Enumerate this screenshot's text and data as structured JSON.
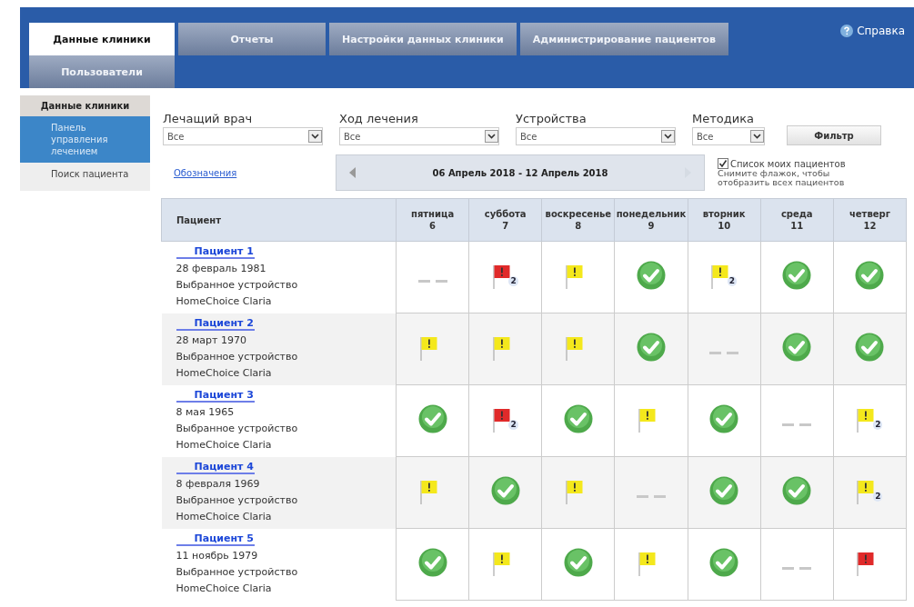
{
  "tabs": [
    {
      "label": "Данные клиники",
      "selected": true
    },
    {
      "label": "Отчеты",
      "selected": false
    },
    {
      "label": "Настройки данных клиники",
      "selected": false
    },
    {
      "label": "Администрирование пациентов",
      "selected": false
    },
    {
      "label": "Пользователи",
      "selected": false
    }
  ],
  "help": "Справка",
  "sidebar": {
    "title": "Данные клиники",
    "items": [
      {
        "label": "Панель управления лечением",
        "selected": true
      },
      {
        "label": "Поиск пациента",
        "selected": false
      }
    ]
  },
  "filters": [
    {
      "label": "Лечащий врач",
      "value": "Все"
    },
    {
      "label": "Ход лечения",
      "value": "Все"
    },
    {
      "label": "Устройства",
      "value": "Все"
    },
    {
      "label": "Методика",
      "value": "Все"
    }
  ],
  "filter_button": "Фильтр",
  "legend_link": "Обозначения",
  "date_range": "06 Апрель 2018 - 12 Апрель 2018",
  "my_patients": {
    "label": "Список моих пациентов",
    "checked": true,
    "hint": "Снимите флажок, чтобы отобразить всех пациентов"
  },
  "table": {
    "patient_header": "Пациент",
    "days": [
      {
        "name": "пятница",
        "num": "6"
      },
      {
        "name": "суббота",
        "num": "7"
      },
      {
        "name": "воскресенье",
        "num": "8"
      },
      {
        "name": "понедельник",
        "num": "9"
      },
      {
        "name": "вторник",
        "num": "10"
      },
      {
        "name": "среда",
        "num": "11"
      },
      {
        "name": "четверг",
        "num": "12"
      }
    ],
    "rows": [
      {
        "name": "Пациент 1",
        "birth": "28 февраль 1981",
        "device_label": "Выбранное устройство",
        "device": "HomeChoice Claria",
        "cells": [
          {
            "kind": "none"
          },
          {
            "kind": "flag",
            "color": "#e02a2a",
            "badge": "2"
          },
          {
            "kind": "flag",
            "color": "#f4e81c"
          },
          {
            "kind": "check"
          },
          {
            "kind": "flag",
            "color": "#f4e81c",
            "badge": "2"
          },
          {
            "kind": "check"
          },
          {
            "kind": "check"
          }
        ]
      },
      {
        "name": "Пациент 2",
        "birth": "28 март 1970",
        "device_label": "Выбранное устройство",
        "device": "HomeChoice Claria",
        "cells": [
          {
            "kind": "flag",
            "color": "#f4e81c"
          },
          {
            "kind": "flag",
            "color": "#f4e81c"
          },
          {
            "kind": "flag",
            "color": "#f4e81c"
          },
          {
            "kind": "check"
          },
          {
            "kind": "none"
          },
          {
            "kind": "check"
          },
          {
            "kind": "check"
          }
        ]
      },
      {
        "name": "Пациент 3",
        "birth": "8 мая 1965",
        "device_label": "Выбранное устройство",
        "device": "HomeChoice Claria",
        "cells": [
          {
            "kind": "check"
          },
          {
            "kind": "flag",
            "color": "#e02a2a",
            "badge": "2"
          },
          {
            "kind": "check"
          },
          {
            "kind": "flag",
            "color": "#f4e81c"
          },
          {
            "kind": "check"
          },
          {
            "kind": "none"
          },
          {
            "kind": "flag",
            "color": "#f4e81c",
            "badge": "2"
          }
        ]
      },
      {
        "name": "Пациент 4",
        "birth": "8 февраля 1969",
        "device_label": "Выбранное устройство",
        "device": "HomeChoice Claria",
        "cells": [
          {
            "kind": "flag",
            "color": "#f4e81c"
          },
          {
            "kind": "check"
          },
          {
            "kind": "flag",
            "color": "#f4e81c"
          },
          {
            "kind": "none"
          },
          {
            "kind": "check"
          },
          {
            "kind": "check"
          },
          {
            "kind": "flag",
            "color": "#f4e81c",
            "badge": "2"
          }
        ]
      },
      {
        "name": "Пациент 5",
        "birth": "11 ноябрь 1979",
        "device_label": "Выбранное устройство",
        "device": "HomeChoice Claria",
        "cells": [
          {
            "kind": "check"
          },
          {
            "kind": "flag",
            "color": "#f4e81c"
          },
          {
            "kind": "check"
          },
          {
            "kind": "flag",
            "color": "#f4e81c"
          },
          {
            "kind": "check"
          },
          {
            "kind": "none"
          },
          {
            "kind": "flag",
            "color": "#e02a2a"
          }
        ]
      }
    ]
  }
}
